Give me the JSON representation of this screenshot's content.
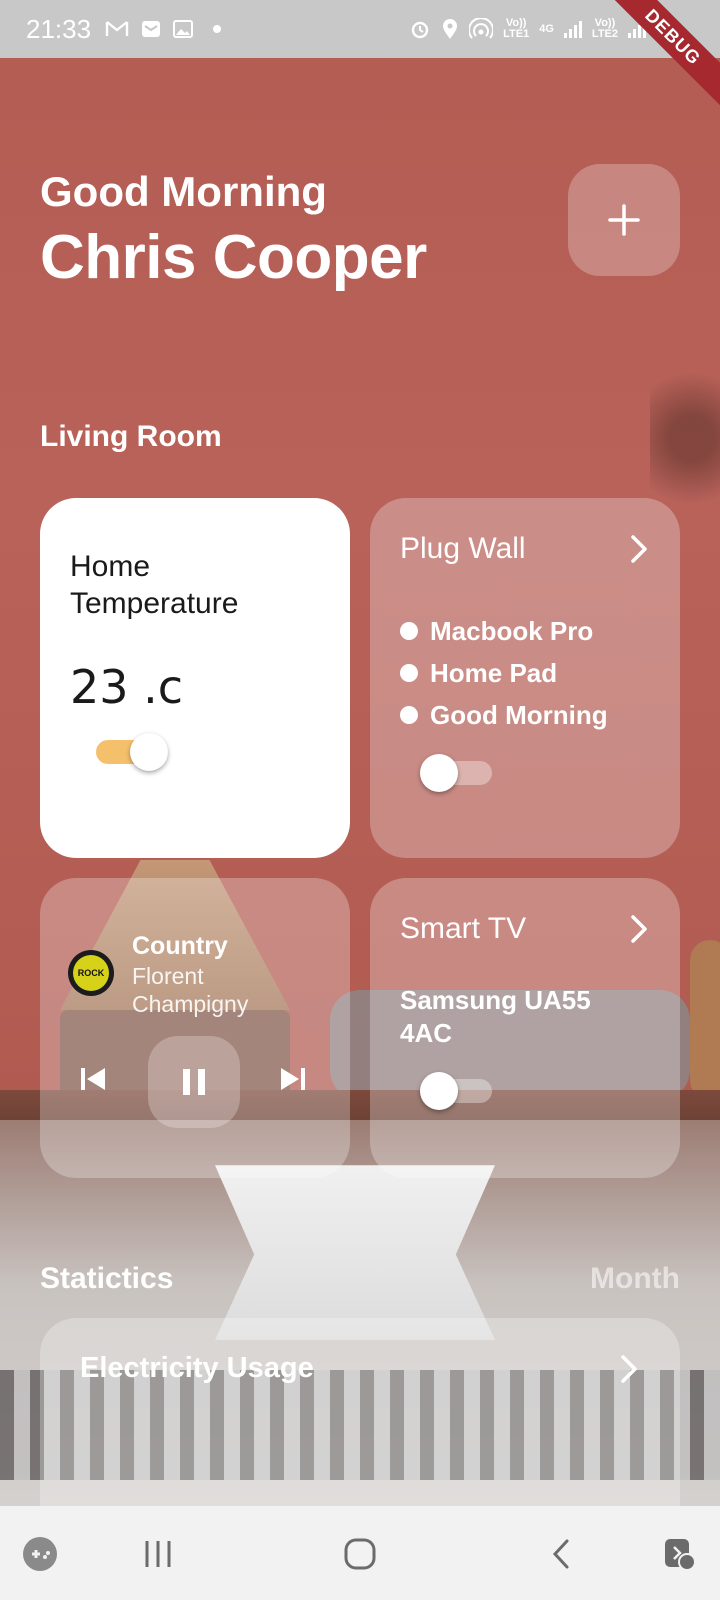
{
  "status_bar": {
    "time": "21:33",
    "left_icons": [
      "gmail-icon",
      "message-icon",
      "gallery-icon",
      "dot-icon"
    ],
    "right_icons": [
      "alarm-icon",
      "location-icon",
      "hotspot-icon",
      "lte1-icon",
      "4g-icon",
      "signal-icon",
      "lte2-icon",
      "signal-icon",
      "battery-icon"
    ],
    "lte1_label": "Vo))\nLTE1",
    "net_label": "4G",
    "lte2_label": "Vo))\nLTE2",
    "debug_label": "DEBUG"
  },
  "greeting": {
    "line1": "Good Morning",
    "name": "Chris Cooper",
    "add_icon": "plus-icon"
  },
  "living_room": {
    "title": "Living Room",
    "temperature_card": {
      "title": "Home Temperature",
      "value": "23 .c",
      "toggle_on": true
    },
    "plug_card": {
      "title": "Plug Wall",
      "items": [
        "Macbook Pro",
        "Home Pad",
        "Good Morning"
      ],
      "toggle_on": false
    },
    "music_card": {
      "track": "Country",
      "artist": "Florent Champigny",
      "album_label": "ROCK",
      "controls": [
        "skip-previous-icon",
        "pause-icon",
        "skip-next-icon"
      ]
    },
    "tv_card": {
      "title": "Smart TV",
      "model": "Samsung UA55 4AC",
      "toggle_on": false
    }
  },
  "statistics": {
    "title": "Statictics",
    "period": "Month",
    "electricity_title": "Electricity Usage"
  },
  "nav_bar": {
    "icons": [
      "game-launcher-icon",
      "recent-apps-icon",
      "home-icon",
      "back-icon",
      "accessibility-icon"
    ]
  },
  "colors": {
    "background": "#b55f55",
    "toggle_on": "#f4c06c",
    "card_white": "#ffffff",
    "debug_ribbon": "#a5292f"
  }
}
